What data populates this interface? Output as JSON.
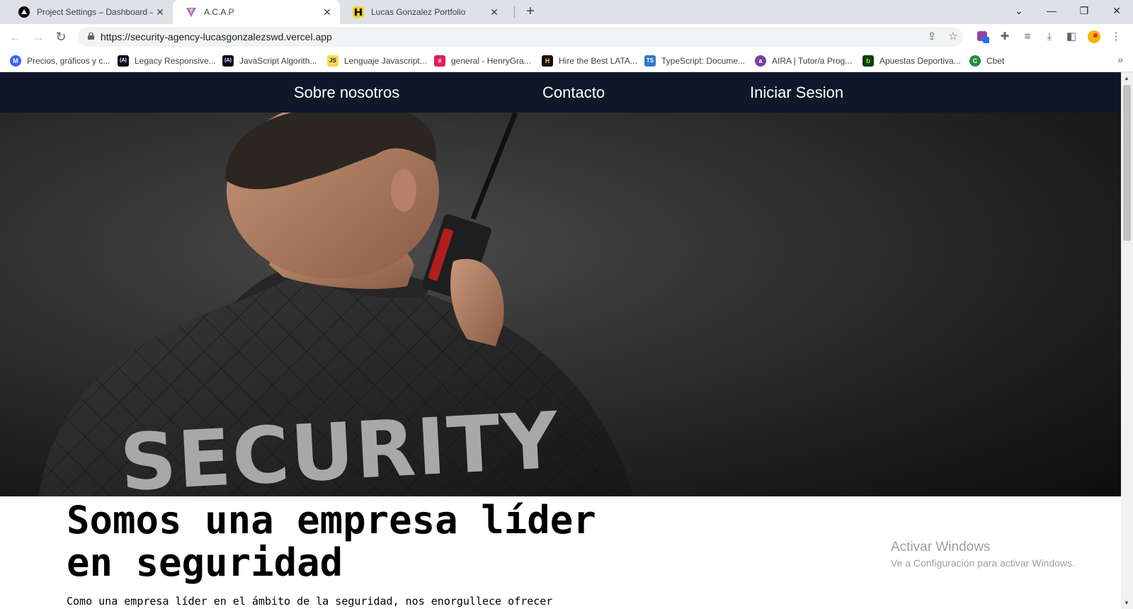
{
  "browser": {
    "tabs": [
      {
        "title": "Project Settings – Dashboard – V",
        "favicon": "vercel-triangle-icon",
        "active": false
      },
      {
        "title": "A.C.A.P",
        "favicon": "vite-logo-icon",
        "active": true
      },
      {
        "title": "Lucas Gonzalez Portfolio",
        "favicon": "portfolio-logo-icon",
        "active": false
      }
    ],
    "new_tab": "+",
    "window_controls": {
      "tab_search": "⌄",
      "minimize": "—",
      "restore": "❐",
      "close": "✕"
    },
    "nav": {
      "back": "←",
      "forward": "→",
      "reload": "↻"
    },
    "url": "https://security-agency-lucasgonzalezswd.vercel.app",
    "bookmarks": [
      {
        "label": "Precios, gráficos y c...",
        "icon": "coinmarketcap-icon",
        "color": "#3861fb",
        "glyph": "M"
      },
      {
        "label": "Legacy Responsive...",
        "icon": "freecodecamp-icon",
        "color": "#0a0a23",
        "glyph": "(A)"
      },
      {
        "label": "JavaScript Algorith...",
        "icon": "freecodecamp-icon",
        "color": "#0a0a23",
        "glyph": "(A)"
      },
      {
        "label": "Lenguaje Javascript...",
        "icon": "js-icon",
        "color": "#f0db4f",
        "glyph": "JS"
      },
      {
        "label": "general - HenryGra...",
        "icon": "slack-icon",
        "color": "#e01e5a",
        "glyph": "#"
      },
      {
        "label": "Hire the Best LATA...",
        "icon": "henry-icon",
        "color": "#111111",
        "glyph": "H"
      },
      {
        "label": "TypeScript: Docume...",
        "icon": "typescript-icon",
        "color": "#3178c6",
        "glyph": "TS"
      },
      {
        "label": "AIRA | Tutor/a Prog...",
        "icon": "aira-icon",
        "color": "#7b3fa0",
        "glyph": "a"
      },
      {
        "label": "Apuestas Deportiva...",
        "icon": "bet-icon",
        "color": "#0b3d0b",
        "glyph": "b"
      },
      {
        "label": "Cbet",
        "icon": "cbet-icon",
        "color": "#1f8f3a",
        "glyph": "C"
      }
    ],
    "bookmarks_more": "»"
  },
  "site": {
    "nav": [
      "Sobre nosotros",
      "Contacto",
      "Iniciar Sesion"
    ],
    "hero_text": "SECURITY",
    "headline": "Somos una empresa líder en seguridad",
    "subtext": "Como una empresa líder en el ámbito de la seguridad, nos enorgullece ofrecer",
    "colors": {
      "navbar": "#0f1829",
      "hero_bg": "#1c1c1c"
    }
  },
  "os": {
    "activate_title": "Activar Windows",
    "activate_sub": "Ve a Configuración para activar Windows."
  }
}
